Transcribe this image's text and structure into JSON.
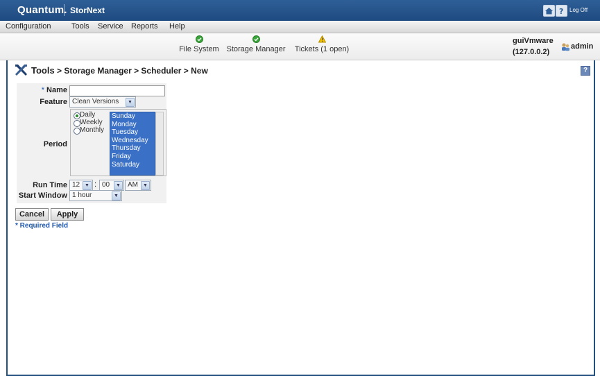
{
  "header": {
    "logo": "Quantum.",
    "product": "StorNext",
    "logoff_label": "Log Off"
  },
  "menu": {
    "items": [
      "Configuration",
      "Tools",
      "Service",
      "Reports",
      "Help"
    ]
  },
  "status": {
    "items": [
      {
        "label": "File System",
        "icon": "check-circle-icon",
        "color": "#3aa53a"
      },
      {
        "label": "Storage Manager",
        "icon": "check-circle-icon",
        "color": "#3aa53a"
      },
      {
        "label": "Tickets (1 open)",
        "icon": "warning-icon",
        "color": "#f2c200"
      }
    ],
    "server_name": "guiVmware",
    "server_ip": "(127.0.0.2)",
    "user": "admin"
  },
  "breadcrumb": {
    "root": "Tools",
    "path": " > Storage Manager > Scheduler > New"
  },
  "form": {
    "name_star": "*",
    "name_label": "Name",
    "name_value": "",
    "feature_label": "Feature",
    "feature_value": "Clean Versions",
    "period_label": "Period",
    "period_options": [
      "Daily",
      "Weekly",
      "Monthly"
    ],
    "period_selected": "Daily",
    "days": [
      "Sunday",
      "Monday",
      "Tuesday",
      "Wednesday",
      "Thursday",
      "Friday",
      "Saturday"
    ],
    "run_time_label": "Run Time",
    "run_hour": "12",
    "run_separator": ":",
    "run_minute": "00",
    "run_ampm": "AM",
    "start_window_label": "Start Window",
    "start_window_value": "1 hour"
  },
  "buttons": {
    "cancel": "Cancel",
    "apply": "Apply"
  },
  "required_note": "* Required Field",
  "colors": {
    "brand_bar": "#1d4a80",
    "selection": "#3a70c6",
    "link": "#1d57b0"
  }
}
